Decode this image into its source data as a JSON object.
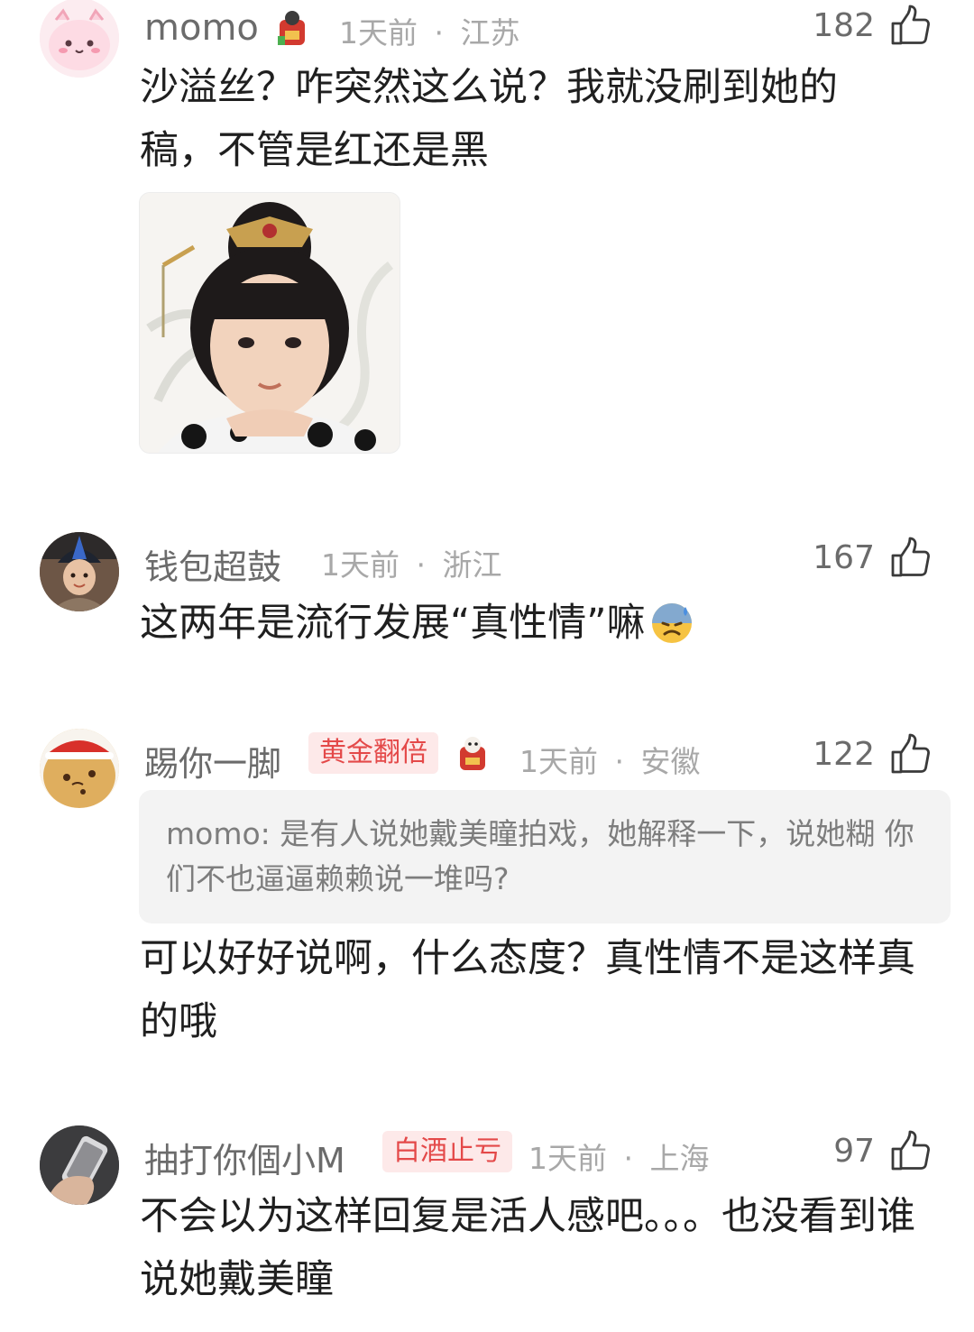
{
  "comments": [
    {
      "username": "momo",
      "time": "1天前",
      "location": "江苏",
      "likes": "182",
      "text": "沙溢丝？咋突然这么说？我就没刷到她的稿，不管是红还是黑"
    },
    {
      "username": "钱包超鼓",
      "time": "1天前",
      "location": "浙江",
      "likes": "167",
      "text": "这两年是流行发展“真性情”嘛"
    },
    {
      "username": "踢你一脚",
      "badge": "黄金翻倍",
      "time": "1天前",
      "location": "安徽",
      "likes": "122",
      "quote": "momo: 是有人说她戴美瞳拍戏，她解释一下，说她糊 你们不也逼逼赖赖说一堆吗?",
      "text": "可以好好说啊，什么态度？真性情不是这样真的哦"
    },
    {
      "username": "抽打你個小M",
      "badge": "白酒止亏",
      "time": "1天前",
      "location": "上海",
      "likes": "97",
      "text": "不会以为这样回复是活人感吧。。。也没看到谁说她戴美瞳"
    }
  ],
  "separator": "·",
  "colors": {
    "username": "#6b6b6b",
    "meta": "#a8a8a8",
    "badge_bg": "#fde9e9",
    "badge_text": "#e44949",
    "quote_bg": "#f3f3f3"
  },
  "icons": [
    "like-thumb-icon",
    "fortune-sticker-icon",
    "sweat-emoji-icon"
  ]
}
